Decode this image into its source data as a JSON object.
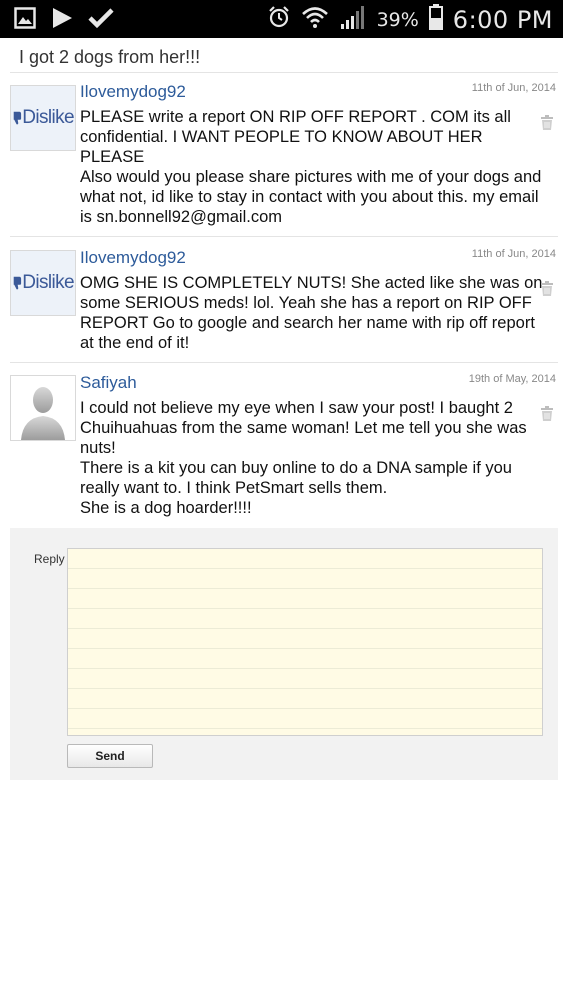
{
  "status_bar": {
    "battery": "39%",
    "time": "6:00 PM"
  },
  "thread": {
    "title": "I got 2 dogs from her!!!"
  },
  "comments": [
    {
      "author": "Ilovemydog92",
      "date": "11th of Jun, 2014",
      "avatar_text": "Dislike",
      "body": "PLEASE write a report ON RIP OFF REPORT . COM its all confidential. I WANT PEOPLE TO KNOW ABOUT HER PLEASE\nAlso would you please share pictures with me of your dogs and what not, id like to stay in contact with you about this. my email is sn.bonnell92@gmail.com"
    },
    {
      "author": "Ilovemydog92",
      "date": "11th of Jun, 2014",
      "avatar_text": "Dislike",
      "body": "OMG SHE IS COMPLETELY NUTS! She acted like she was on some SERIOUS meds! lol. Yeah she has a report on RIP OFF REPORT Go to google and search her name with rip off report at the end of it!"
    },
    {
      "author": "Safiyah",
      "date": "19th of May, 2014",
      "body": "I could not believe my eye when I saw your post! I baught 2 Chuihuahuas from the same woman! Let me tell you she was nuts!\nThere is a kit you can buy online to do a DNA sample if you really want to. I think PetSmart sells them.\nShe is a dog hoarder!!!!"
    }
  ],
  "reply": {
    "label": "Reply",
    "value": "",
    "send_label": "Send"
  },
  "colors": {
    "author_link": "#2d5b9a",
    "reply_bg": "#fffbe5",
    "status_bar": "#000000"
  }
}
